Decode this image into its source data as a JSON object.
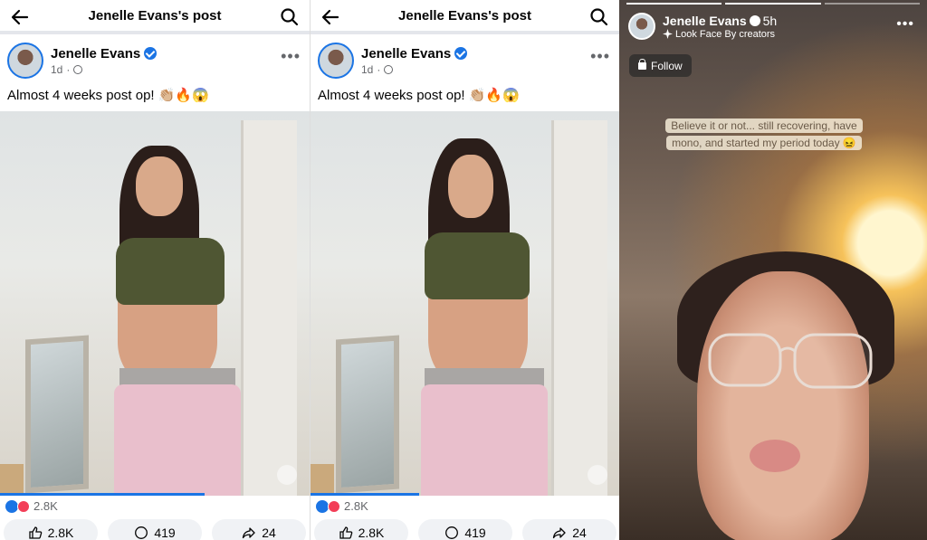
{
  "colors": {
    "fb_blue": "#1b74e4",
    "love_red": "#f33e58",
    "text_secondary": "#65676b",
    "button_bg": "#f0f2f5"
  },
  "icons": [
    "back-arrow-icon",
    "search-icon",
    "verified-badge-icon",
    "globe-icon",
    "more-icon",
    "like-reaction-icon",
    "love-reaction-icon",
    "thumbs-up-icon",
    "comment-icon",
    "share-icon",
    "mute-icon",
    "lock-icon",
    "sparkle-icon"
  ],
  "panel1": {
    "topbar": {
      "title": "Jenelle Evans's post"
    },
    "post": {
      "author": "Jenelle Evans",
      "time": "1d",
      "separator": "·",
      "caption": "Almost 4 weeks post op! 👏🏼🔥😱",
      "video_progress": 0.66,
      "reaction_count": "2.8K",
      "actions": {
        "like": "2.8K",
        "comment": "419",
        "share": "24"
      }
    }
  },
  "panel2": {
    "topbar": {
      "title": "Jenelle Evans's post"
    },
    "post": {
      "author": "Jenelle Evans",
      "time": "1d",
      "separator": "·",
      "caption": "Almost 4 weeks post op! 👏🏼🔥😱",
      "video_progress": 0.35,
      "reaction_count": "2.8K",
      "actions": {
        "like": "2.8K",
        "comment": "419",
        "share": "24"
      }
    }
  },
  "story": {
    "user": "Jenelle Evans",
    "time": "5h",
    "effect": "Look Face By creators",
    "follow_label": "Follow",
    "caption": "Believe it or not... still recovering, have mono, and started my period today 😖",
    "segments_total": 3,
    "segments_done": 2
  }
}
